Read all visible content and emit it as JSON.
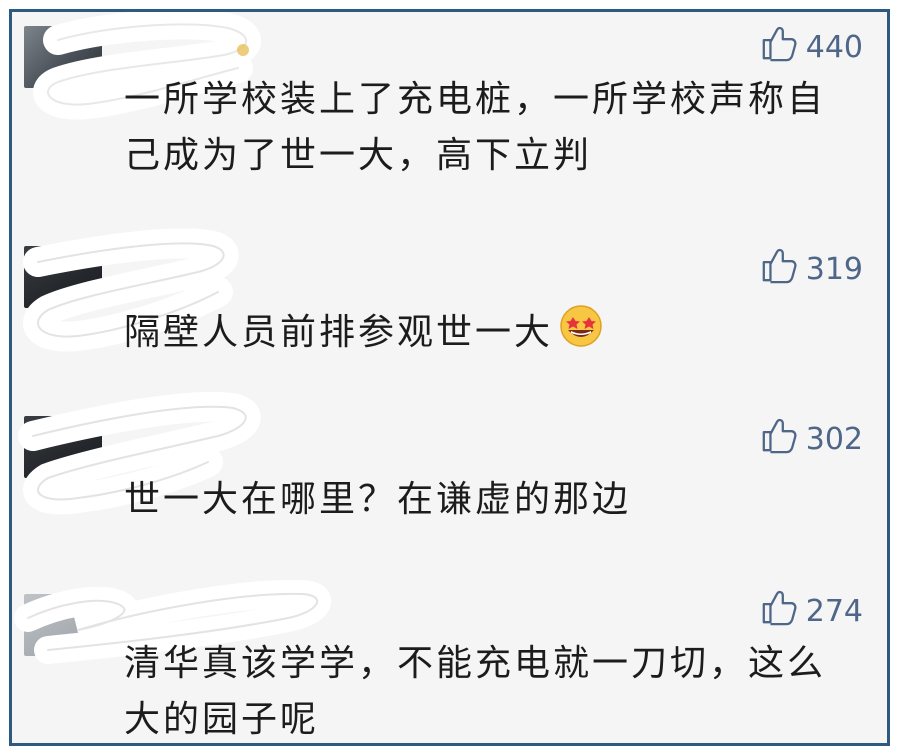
{
  "comments": [
    {
      "likes": "440",
      "text": "一所学校装上了充电桩，一所学校声称自己成为了世一大，高下立判"
    },
    {
      "likes": "319",
      "text": "隔壁人员前排参观世一大"
    },
    {
      "username_partial": "物",
      "likes": "302",
      "text": "世一大在哪里？在谦虚的那边"
    },
    {
      "username_partial": "D",
      "likes": "274",
      "text": "清华真该学学，不能充电就一刀切，这么大的园子呢"
    }
  ],
  "icons": {
    "like": "thumbs-up-icon",
    "emoji": "star-struck-face-emoji"
  },
  "colors": {
    "border": "#2f5a80",
    "background": "#f5f5f5",
    "like_text": "#4e6688",
    "comment_text": "#1c1c1c"
  }
}
